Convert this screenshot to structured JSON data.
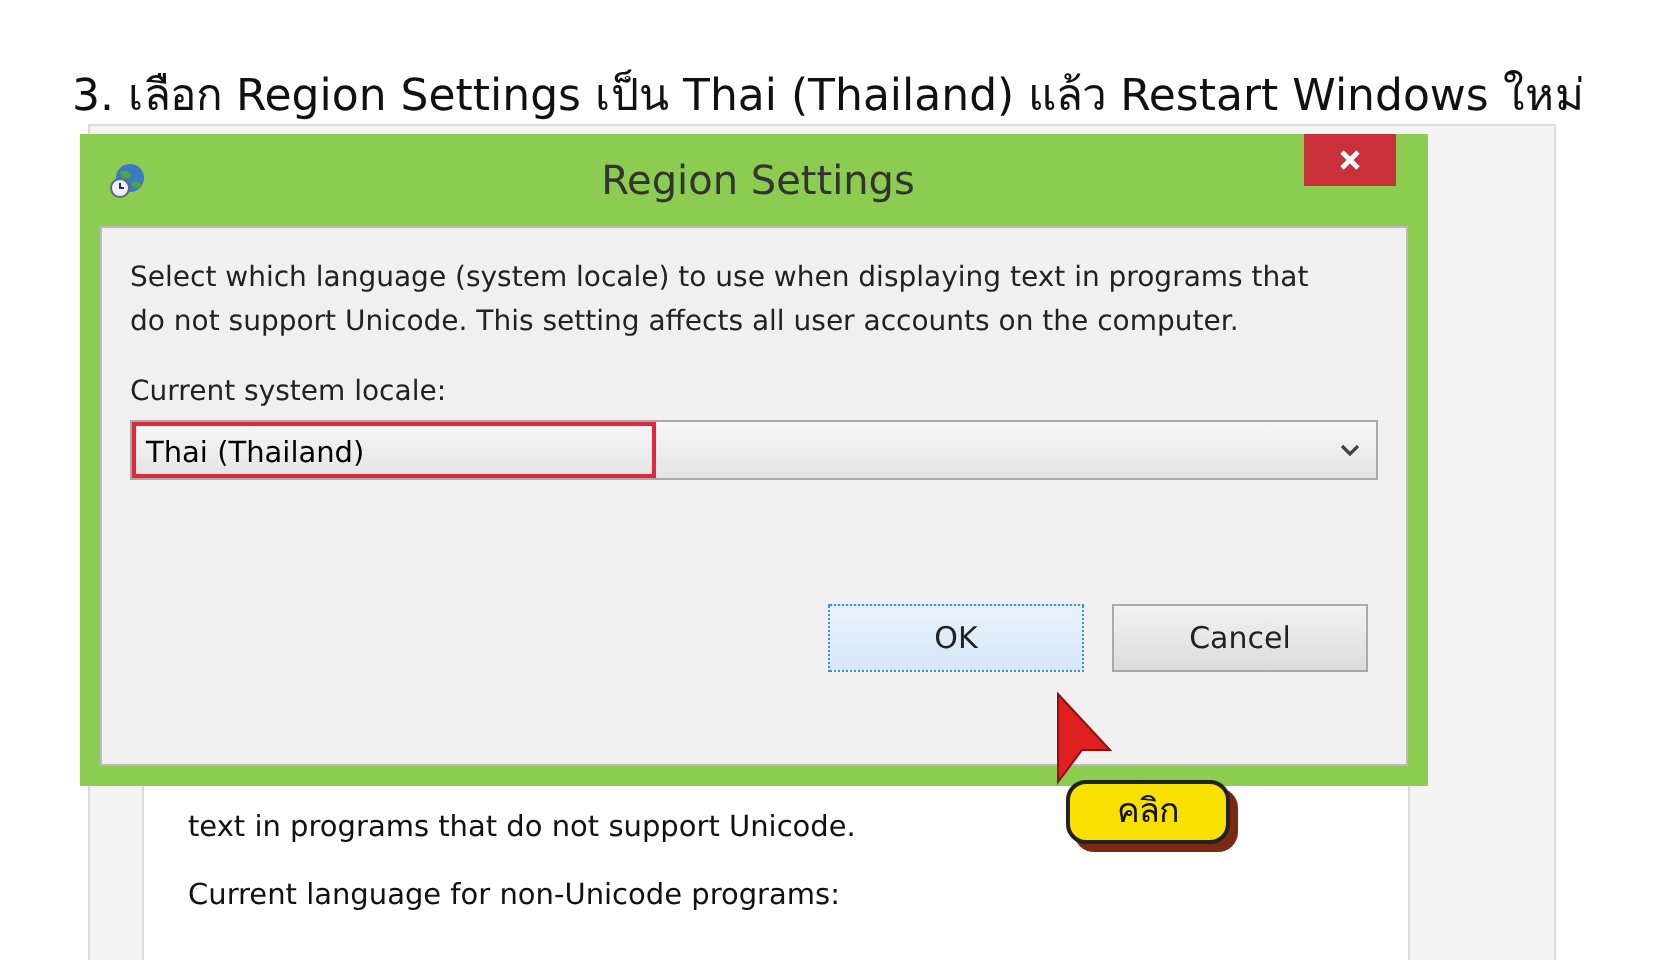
{
  "heading": "3. เลือก Region Settings เป็น Thai (Thailand) แล้ว Restart Windows ใหม่",
  "background_window": {
    "lines": [
      "text in programs that do not support Unicode.",
      "Current language for non-Unicode programs:"
    ]
  },
  "dialog": {
    "title": "Region Settings",
    "description": "Select which language (system locale) to use when displaying text in programs that do not support Unicode. This setting affects all user accounts on the computer.",
    "locale_label": "Current system locale:",
    "locale_value": "Thai (Thailand)",
    "highlighted": true,
    "buttons": [
      {
        "label": "OK",
        "selected": true
      },
      {
        "label": "Cancel",
        "selected": false
      }
    ]
  },
  "callout": "คลิก"
}
